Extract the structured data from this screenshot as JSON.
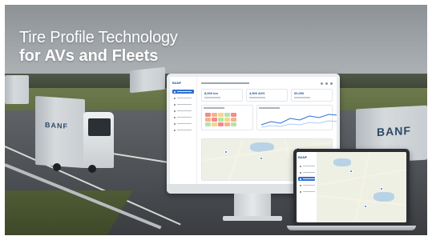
{
  "headline": {
    "line1": "Tire Profile Technology",
    "line2": "for AVs and Fleets"
  },
  "truck_brand": "BANF",
  "dashboard": {
    "logo": "BANF",
    "kpis": [
      {
        "value": "8,000 km"
      },
      {
        "value": "4,900 AVG"
      },
      {
        "value": "00,000"
      }
    ],
    "nav_items": [
      {
        "active": true
      },
      {
        "active": false
      },
      {
        "active": false
      },
      {
        "active": false
      },
      {
        "active": false
      },
      {
        "active": false
      },
      {
        "active": false
      }
    ],
    "heat_colors": [
      "#f08c8c",
      "#f5b38a",
      "#f7d58a",
      "#b6e3a8",
      "#f08c8c",
      "#f5b38a",
      "#f08c8c",
      "#b6e3a8",
      "#f7d58a",
      "#f5b38a",
      "#b6e3a8",
      "#f7d58a",
      "#f08c8c",
      "#f5b38a",
      "#b6e3a8"
    ]
  },
  "laptop": {
    "logo": "BANF",
    "nav_items": [
      {
        "active": false
      },
      {
        "active": false
      },
      {
        "active": true
      },
      {
        "active": false
      },
      {
        "active": false
      }
    ]
  },
  "colors": {
    "accent": "#2f6fd6",
    "brand": "#1f4f8a",
    "headline": "#ffffff"
  }
}
